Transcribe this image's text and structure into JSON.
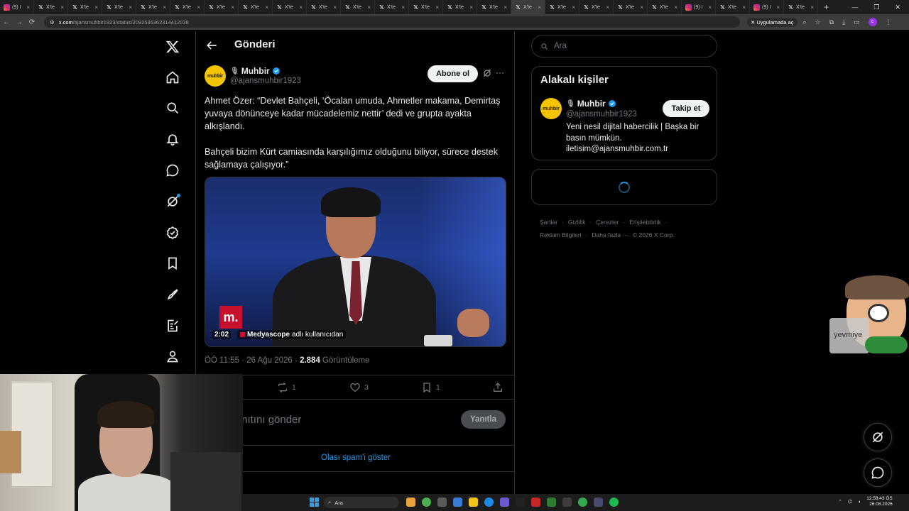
{
  "browser": {
    "tabs": [
      {
        "icon": "instagram-icon",
        "label": "(9) I"
      },
      {
        "icon": "x-icon",
        "label": "X'te"
      },
      {
        "icon": "x-icon",
        "label": "X'te"
      },
      {
        "icon": "x-icon",
        "label": "X'te"
      },
      {
        "icon": "x-icon",
        "label": "X'te"
      },
      {
        "icon": "x-icon",
        "label": "X'te"
      },
      {
        "icon": "x-icon",
        "label": "X'te"
      },
      {
        "icon": "x-icon",
        "label": "X'te"
      },
      {
        "icon": "x-icon",
        "label": "X'te"
      },
      {
        "icon": "x-icon",
        "label": "X'te"
      },
      {
        "icon": "x-icon",
        "label": "X'te"
      },
      {
        "icon": "x-icon",
        "label": "X'te"
      },
      {
        "icon": "x-icon",
        "label": "X'te"
      },
      {
        "icon": "x-icon",
        "label": "X'te"
      },
      {
        "icon": "x-icon",
        "label": "X'te"
      },
      {
        "icon": "x-icon",
        "label": "X'te",
        "active": true
      },
      {
        "icon": "x-icon",
        "label": "X'te"
      },
      {
        "icon": "x-icon",
        "label": "X'te"
      },
      {
        "icon": "x-icon",
        "label": "X'te"
      },
      {
        "icon": "x-icon",
        "label": "X'te"
      },
      {
        "icon": "instagram-icon",
        "label": "(9) I"
      },
      {
        "icon": "x-icon",
        "label": "X'te"
      },
      {
        "icon": "instagram-icon",
        "label": "(9) I"
      },
      {
        "icon": "x-icon",
        "label": "X'te"
      }
    ],
    "url_host": "x.com",
    "url_path": "/ajansmuhbir1923/status/2092536362314412038",
    "app_chip": "Uygulamada aç"
  },
  "post_header": {
    "title": "Gönderi"
  },
  "author": {
    "avatar_text": "muhbir",
    "name": "Muhbir",
    "handle": "@ajansmuhbir1923",
    "subscribe_label": "Abone ol"
  },
  "post": {
    "text": "Ahmet Özer: “Devlet Bahçeli, ‘Öcalan umuda, Ahmetler makama, Demirtaş yuvaya dönünceye kadar mücadelemiz nettir’ dedi ve grupta ayakta alkışlandı.\n\nBahçeli bizim Kürt camiasında karşılığımız olduğunu biliyor, sürece destek sağlamaya çalışıyor.”",
    "media": {
      "logo": "m.",
      "duration": "2:02",
      "source_name": "Medyascope",
      "source_suffix": "adlı kullanıcıdan"
    },
    "time": "ÖÖ 11:55 · 26 Ağu 2026 ·",
    "views_count": "2.884",
    "views_label": "Görüntüleme",
    "actions": {
      "replies": "",
      "reposts": "1",
      "likes": "3",
      "bookmarks": "1"
    }
  },
  "reply": {
    "placeholder": "ınıtını gönder",
    "button_label": "Yanıtla",
    "spam_link": "Olası spam'i göster"
  },
  "search": {
    "placeholder": "Ara"
  },
  "related": {
    "title": "Alakalı kişiler",
    "name": "Muhbir",
    "handle": "@ajansmuhbir1923",
    "follow_label": "Takip et",
    "bio_line1": "Yeni nesil dijital habercilik | Başka bir basın mümkün.",
    "bio_line2": "iletisim@ajansmuhbir.com.tr"
  },
  "footer": {
    "links": [
      "Şartlar",
      "Gizlilik",
      "Çerezler",
      "Erişilebilirlik",
      "Reklam Bilgileri",
      "Daha fazla ···",
      "© 2026 X Corp."
    ]
  },
  "overlay": {
    "mascot_label": "yevmiye"
  },
  "taskbar": {
    "search_placeholder": "Ara",
    "clock_time": "12:58:43 ÖS",
    "clock_date": "26.08.2026"
  },
  "colors": {
    "accent": "#1d9bf0",
    "background": "#000000",
    "border": "#2f3336",
    "muted_text": "#71767b"
  }
}
